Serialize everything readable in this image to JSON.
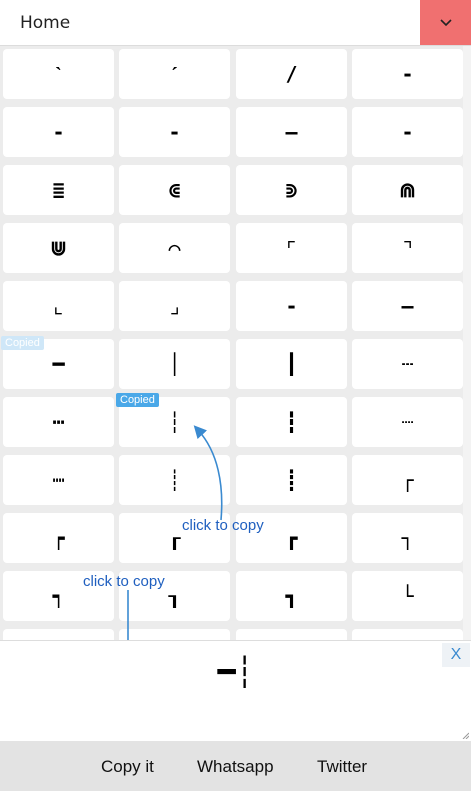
{
  "header": {
    "title": "Home",
    "dropdown_icon": "chevron-down-icon"
  },
  "grid": {
    "cells": [
      "ˋ",
      "ˊ",
      "/",
      "-",
      "-",
      "-",
      "—",
      "-",
      "≣",
      "⋐",
      "⋑",
      "⋒",
      "⋓",
      "⌒",
      "⌜",
      "⌝",
      "⌞",
      "⌟",
      "-",
      "—",
      "━",
      "│",
      "┃",
      "┄",
      "┅",
      "┆",
      "┇",
      "┈",
      "┉",
      "┊",
      "┋",
      "┌",
      "┍",
      "┎",
      "┏",
      "┐",
      "┑",
      "┒",
      "┓",
      "└",
      "╵",
      "╹",
      "╹",
      "╵"
    ]
  },
  "badges": {
    "copied_label": "Copied",
    "copied_label_faded": "Copied"
  },
  "hints": {
    "hint_1": "click to copy",
    "hint_2": "click to copy"
  },
  "output": {
    "value": "━┆",
    "clear_label": "X"
  },
  "actions": {
    "copy_label": "Copy it",
    "whatsapp_label": "Whatsapp",
    "twitter_label": "Twitter"
  },
  "colors": {
    "accent": "#f07070",
    "badge": "#4aa8e8",
    "hint": "#1f5fbf",
    "arrow": "#3a8ad0"
  }
}
